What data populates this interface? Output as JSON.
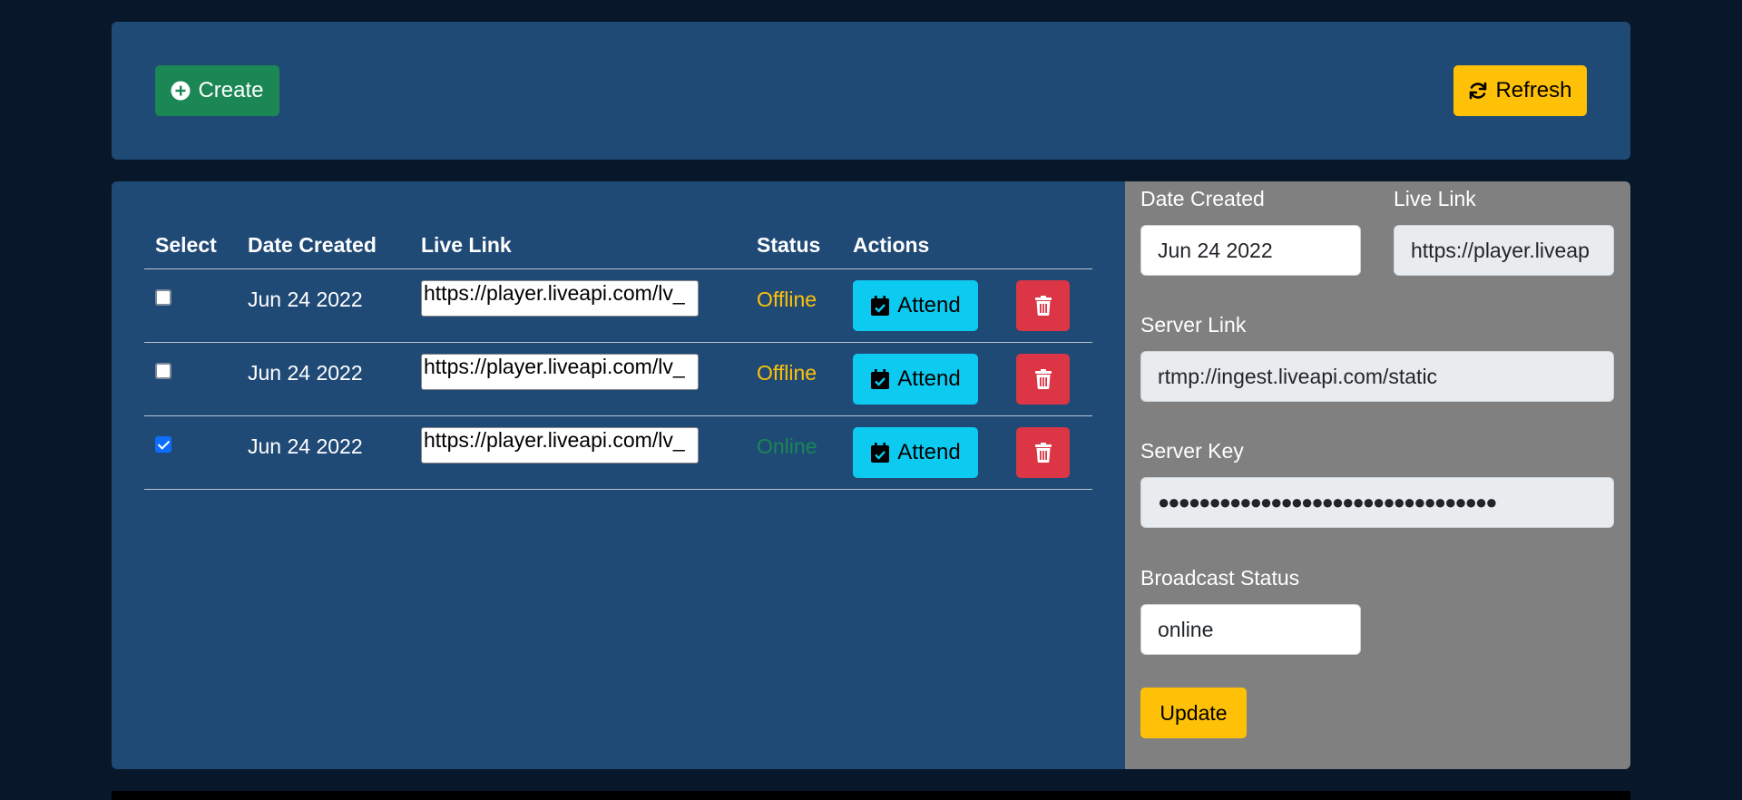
{
  "toolbar": {
    "create_label": "Create",
    "refresh_label": "Refresh"
  },
  "table": {
    "headers": [
      "Select",
      "Date Created",
      "Live Link",
      "Status",
      "Actions"
    ],
    "rows": [
      {
        "checked": false,
        "date": "Jun 24 2022",
        "link": "https://player.liveapi.com/lv_",
        "status": "Offline",
        "attend_label": "Attend"
      },
      {
        "checked": false,
        "date": "Jun 24 2022",
        "link": "https://player.liveapi.com/lv_",
        "status": "Offline",
        "attend_label": "Attend"
      },
      {
        "checked": true,
        "date": "Jun 24 2022",
        "link": "https://player.liveapi.com/lv_",
        "status": "Online",
        "attend_label": "Attend"
      }
    ]
  },
  "details": {
    "date_label": "Date Created",
    "date_value": "Jun 24 2022",
    "live_link_label": "Live Link",
    "live_link_value": "https://player.liveap",
    "server_link_label": "Server Link",
    "server_link_value": "rtmp://ingest.liveapi.com/static",
    "server_key_label": "Server Key",
    "server_key_value": "●●●●●●●●●●●●●●●●●●●●●●●●●●●●●●●●●",
    "broadcast_status_label": "Broadcast Status",
    "broadcast_status_value": "online",
    "update_label": "Update"
  },
  "colors": {
    "background": "#08172a",
    "panel": "#204a76",
    "side_panel": "#808080",
    "create": "#1a8754",
    "refresh": "#ffc107",
    "attend": "#0dcaf0",
    "delete": "#dc3545",
    "offline": "#ffc107",
    "online": "#198754"
  },
  "icons": {
    "create": "plus-circle-icon",
    "refresh": "refresh-icon",
    "attend": "calendar-check-icon",
    "delete": "trash-icon"
  }
}
